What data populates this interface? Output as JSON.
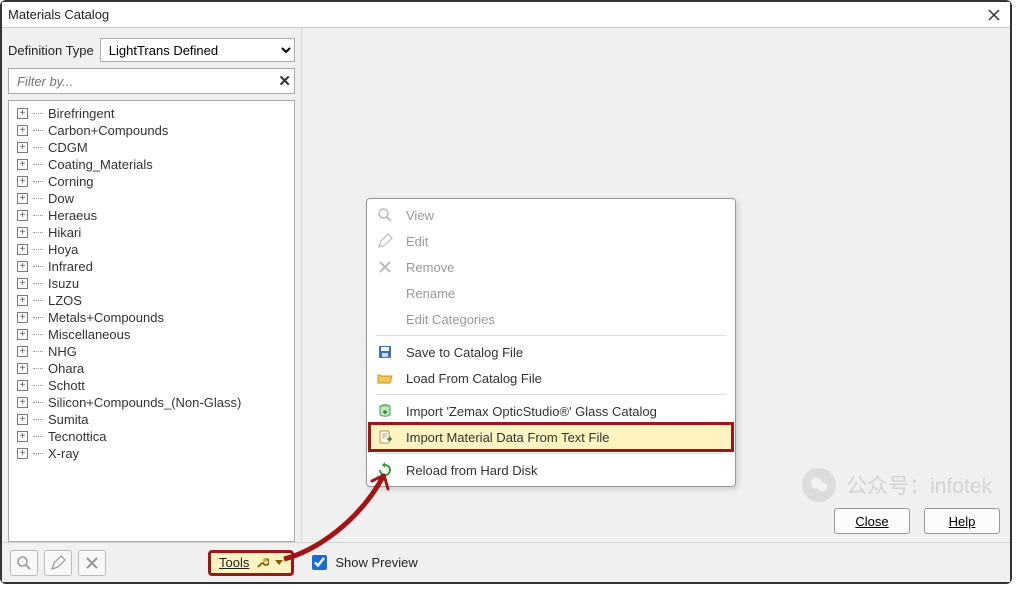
{
  "window": {
    "title": "Materials Catalog"
  },
  "definition": {
    "label": "Definition Type",
    "value": "LightTrans Defined"
  },
  "filter": {
    "placeholder": "Filter by..."
  },
  "tree": [
    "Birefringent",
    "Carbon+Compounds",
    "CDGM",
    "Coating_Materials",
    "Corning",
    "Dow",
    "Heraeus",
    "Hikari",
    "Hoya",
    "Infrared",
    "Isuzu",
    "LZOS",
    "Metals+Compounds",
    "Miscellaneous",
    "NHG",
    "Ohara",
    "Schott",
    "Silicon+Compounds_(Non-Glass)",
    "Sumita",
    "Tecnottica",
    "X-ray"
  ],
  "toolbar": {
    "tools_label": "Tools",
    "show_preview": "Show Preview"
  },
  "context_menu": {
    "view": "View",
    "edit": "Edit",
    "remove": "Remove",
    "rename": "Rename",
    "edit_categories": "Edit Categories",
    "save_catalog": "Save to Catalog File",
    "load_catalog": "Load From Catalog File",
    "import_zemax": "Import 'Zemax OpticStudio®' Glass Catalog",
    "import_text": "Import Material Data From Text File",
    "reload": "Reload from Hard Disk"
  },
  "buttons": {
    "close": "Close",
    "help": "Help"
  },
  "watermark": "公众号：infotek"
}
